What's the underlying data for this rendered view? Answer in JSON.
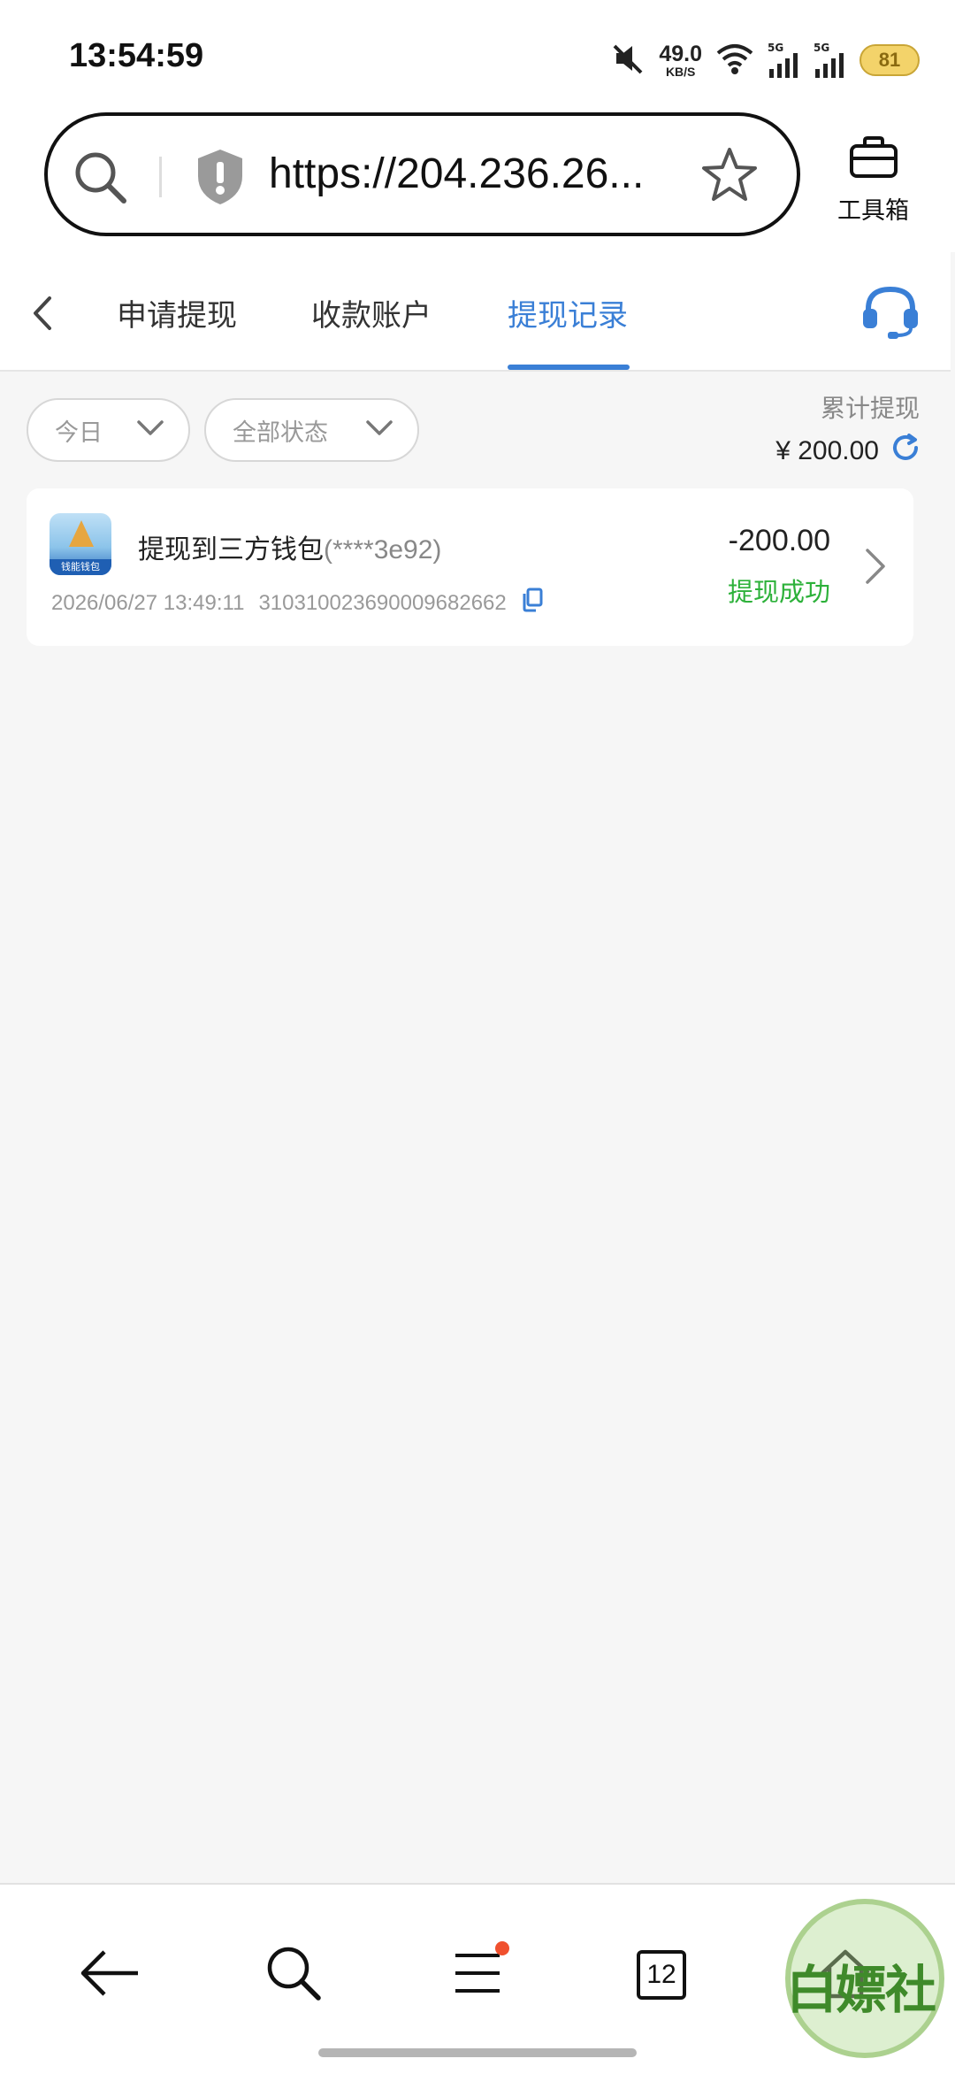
{
  "status_bar": {
    "time": "13:54:59",
    "net_speed_value": "49.0",
    "net_speed_unit": "KB/S",
    "signal_1": "5G",
    "signal_2": "5G",
    "battery": "81"
  },
  "browser": {
    "url": "https://204.236.26...",
    "toolbox_label": "工具箱"
  },
  "tabs": [
    {
      "label": "申请提现",
      "active": false
    },
    {
      "label": "收款账户",
      "active": false
    },
    {
      "label": "提现记录",
      "active": true
    }
  ],
  "filters": {
    "date": "今日",
    "status": "全部状态"
  },
  "summary": {
    "label": "累计提现",
    "amount": "¥ 200.00"
  },
  "records": [
    {
      "title": "提现到三方钱包",
      "account_masked": "(****3e92)",
      "datetime": "2026/06/27 13:49:11",
      "order_no": "310310023690009682662",
      "amount": "-200.00",
      "status": "提现成功",
      "logo_text": "钱能钱包"
    }
  ],
  "bottom_nav": {
    "tab_count": "12"
  },
  "watermark": "白嫖社",
  "colors": {
    "accent": "#3a7fd6",
    "success": "#2db13a",
    "notification_dot": "#f0502e"
  }
}
